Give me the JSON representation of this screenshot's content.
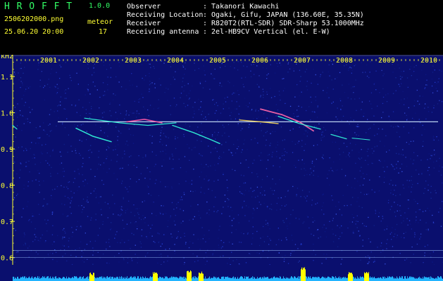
{
  "header": {
    "app_name": "H R O F F T",
    "version": "1.0.0",
    "filename": "2506202000.png",
    "datetime": "25.06.20 20:00",
    "event_type": "meteor",
    "event_count": "17",
    "info_labels": [
      "Observer",
      "Receiving Location",
      "Receiver",
      "Receiving antenna"
    ],
    "info_values": [
      ": Takanori Kawachi",
      ": Ogaki, Gifu, JAPAN (136.60E, 35.35N)",
      ": R820T2(RTL-SDR) SDR-Sharp 53.1000MHz",
      ": 2el-HB9CV Vertical (el. E-W)"
    ]
  },
  "chart_data": {
    "type": "heatmap",
    "y_unit": "kHz",
    "x_ticks": [
      "2001",
      "2002",
      "2003",
      "2004",
      "2005",
      "2006",
      "2007",
      "2008",
      "2009",
      "2010"
    ],
    "y_ticks": [
      "1.1",
      "1.0",
      "0.9",
      "0.8",
      "0.7",
      "0.6"
    ],
    "ylim": [
      0.58,
      1.16
    ],
    "carrier_khz": 0.975,
    "colors": {
      "background": "#0a0f6e",
      "axis": "#ffff33",
      "carrier": "#cfe8ff",
      "meteor": "#33ffdd",
      "bottom_band": "#0a0f6e",
      "amplitude": "#22b4ff",
      "amplitude_peak": "#ffff00"
    }
  }
}
